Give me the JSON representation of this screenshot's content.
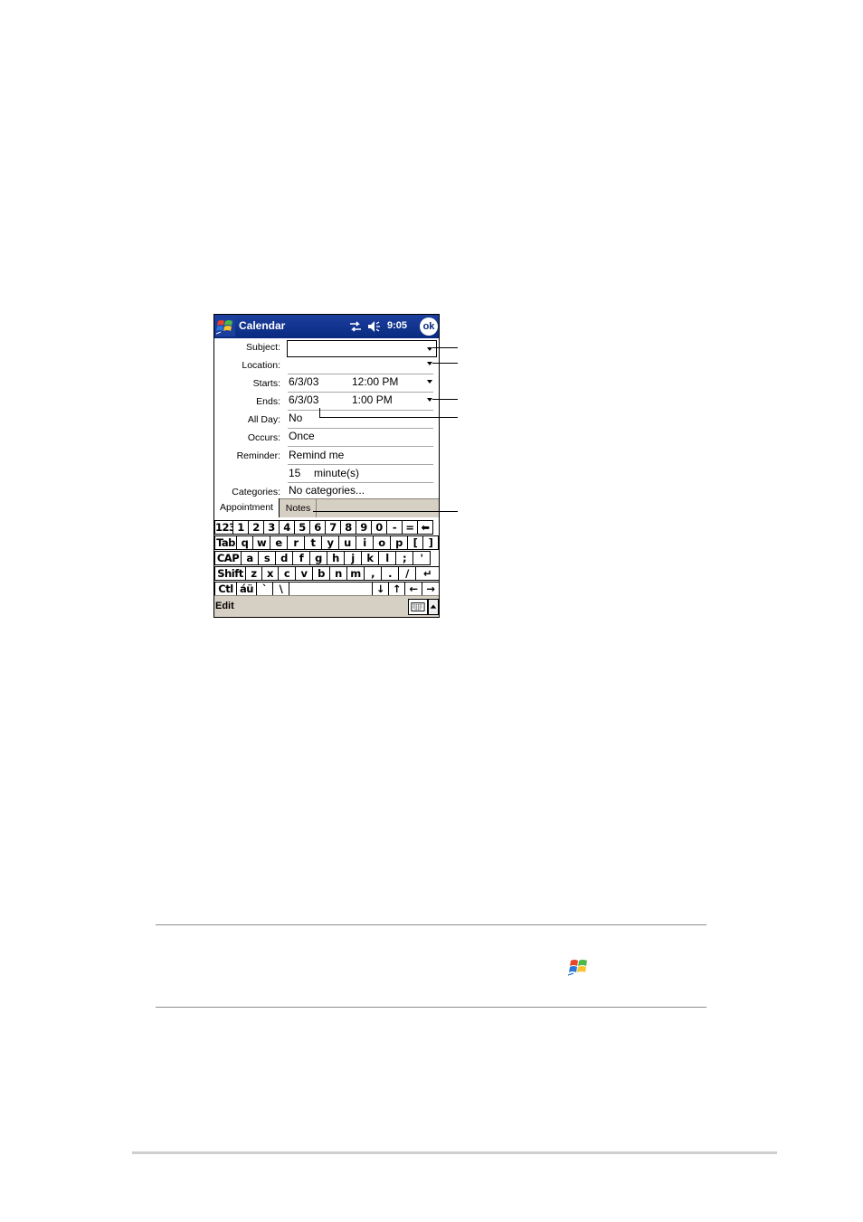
{
  "titlebar": {
    "title": "Calendar",
    "time": "9:05",
    "ok_label": "ok",
    "icons": [
      "windows-start-icon",
      "sync-icon",
      "speaker-icon"
    ]
  },
  "form": {
    "subject_label": "Subject:",
    "location_label": "Location:",
    "starts_label": "Starts:",
    "starts_date": "6/3/03",
    "starts_time": "12:00 PM",
    "ends_label": "Ends:",
    "ends_date": "6/3/03",
    "ends_time": "1:00 PM",
    "allday_label": "All Day:",
    "allday_value": "No",
    "occurs_label": "Occurs:",
    "occurs_value": "Once",
    "reminder_label": "Reminder:",
    "reminder_value": "Remind me",
    "reminder_amount": "15",
    "reminder_unit": "minute(s)",
    "categories_label": "Categories:",
    "categories_value": "No categories..."
  },
  "tabs": {
    "appointment": "Appointment",
    "notes": "Notes"
  },
  "keyboard": {
    "rows": [
      [
        "123",
        "1",
        "2",
        "3",
        "4",
        "5",
        "6",
        "7",
        "8",
        "9",
        "0",
        "-",
        "=",
        "⬅"
      ],
      [
        "Tab",
        "q",
        "w",
        "e",
        "r",
        "t",
        "y",
        "u",
        "i",
        "o",
        "p",
        "[",
        "]"
      ],
      [
        "CAP",
        "a",
        "s",
        "d",
        "f",
        "g",
        "h",
        "j",
        "k",
        "l",
        ";",
        "'"
      ],
      [
        "Shift",
        "z",
        "x",
        "c",
        "v",
        "b",
        "n",
        "m",
        ",",
        ".",
        "/",
        "↵"
      ],
      [
        "Ctl",
        "áü",
        "`",
        "\\",
        "",
        "↓",
        "↑",
        "←",
        "→"
      ]
    ]
  },
  "menubar": {
    "edit": "Edit"
  },
  "colors": {
    "titlebar": "#0a2a80",
    "bar_background": "#d6cfc3",
    "field_line": "#a7a7a7"
  }
}
